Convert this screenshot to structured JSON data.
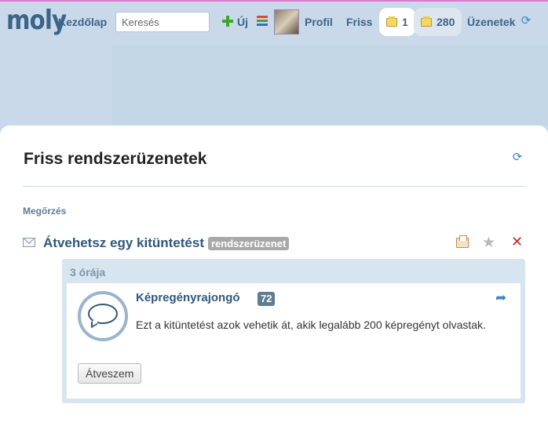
{
  "nav": {
    "logo": "moly",
    "home": "Kezdőlap",
    "search_placeholder": "Keresés",
    "new": "Új",
    "profile": "Profil",
    "fresh": "Friss",
    "books_count": "1",
    "shelf_count": "280",
    "messages": "Üzenetek"
  },
  "page": {
    "title": "Friss rendszerüzenetek",
    "section_label": "Megőrzés"
  },
  "message": {
    "title": "Átvehetsz egy kitüntetést",
    "tag": "rendszerüzenet",
    "time_ago": "3 órája",
    "badge_name": "Képregényrajongó",
    "badge_count": "72",
    "description": "Ezt a kitüntetést azok vehetik át, akik legalább 200 képregényt olvastak.",
    "accept_label": "Átveszem"
  },
  "colors": {
    "accent": "#3b6488",
    "background": "#c9d9ea",
    "delete": "#cc2222"
  },
  "icons": [
    "plus-icon",
    "stack-icon",
    "book-icon",
    "refresh-icon",
    "envelope-icon",
    "archive-icon",
    "star-icon",
    "delete-icon",
    "share-icon",
    "badge-icon"
  ]
}
